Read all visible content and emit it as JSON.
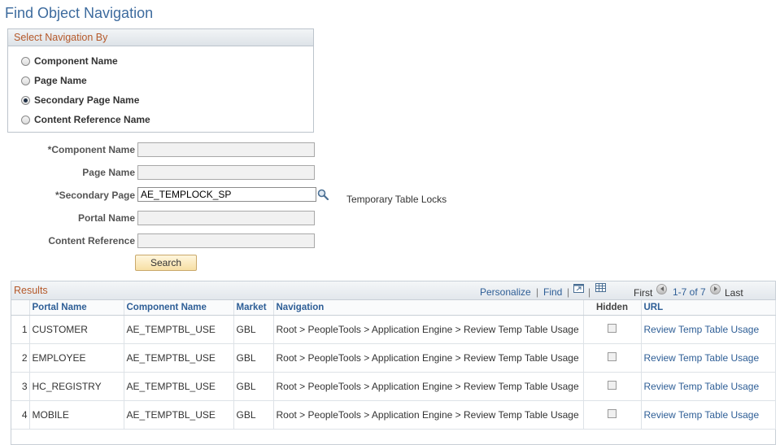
{
  "page_title": "Find Object Navigation",
  "nav_group": {
    "title": "Select Navigation By",
    "options": [
      {
        "label": "Component Name",
        "selected": false
      },
      {
        "label": "Page Name",
        "selected": false
      },
      {
        "label": "Secondary Page Name",
        "selected": true
      },
      {
        "label": "Content Reference Name",
        "selected": false
      }
    ]
  },
  "form": {
    "component_label": "*Component Name",
    "component_value": "",
    "page_label": "Page Name",
    "page_value": "",
    "secondary_label": "*Secondary Page",
    "secondary_value": "AE_TEMPLOCK_SP",
    "secondary_desc": "Temporary Table Locks",
    "portal_label": "Portal Name",
    "portal_value": "",
    "content_label": "Content Reference",
    "content_value": "",
    "search_label": "Search"
  },
  "results": {
    "title": "Results",
    "personalize": "Personalize",
    "find": "Find",
    "sep": "|",
    "first": "First",
    "range": "1-7 of 7",
    "last": "Last",
    "columns": [
      "",
      "Portal Name",
      "Component Name",
      "Market",
      "Navigation",
      "Hidden",
      "URL"
    ],
    "rows": [
      {
        "num": "1",
        "portal": "CUSTOMER",
        "component": "AE_TEMPTBL_USE",
        "market": "GBL",
        "navigation": "Root > PeopleTools > Application Engine > Review Temp Table Usage",
        "url": "Review Temp Table Usage"
      },
      {
        "num": "2",
        "portal": "EMPLOYEE",
        "component": "AE_TEMPTBL_USE",
        "market": "GBL",
        "navigation": "Root > PeopleTools > Application Engine > Review Temp Table Usage",
        "url": "Review Temp Table Usage"
      },
      {
        "num": "3",
        "portal": "HC_REGISTRY",
        "component": "AE_TEMPTBL_USE",
        "market": "GBL",
        "navigation": "Root > PeopleTools > Application Engine > Review Temp Table Usage",
        "url": "Review Temp Table Usage"
      },
      {
        "num": "4",
        "portal": "MOBILE",
        "component": "AE_TEMPTBL_USE",
        "market": "GBL",
        "navigation": "Root > PeopleTools > Application Engine > Review Temp Table Usage",
        "url": "Review Temp Table Usage"
      }
    ]
  },
  "colors": {
    "title": "#3d6b9e",
    "group_title": "#b5592a",
    "link": "#2e5e96"
  },
  "icons": [
    "lookup-magnifier-icon",
    "zoom-icon",
    "download-grid-icon",
    "previous-arrow-icon",
    "next-arrow-icon"
  ]
}
